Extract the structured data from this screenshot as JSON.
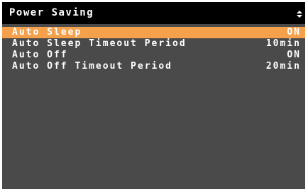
{
  "header": {
    "title": "Power Saving",
    "scroll_icon": "up-down-arrows-icon"
  },
  "colors": {
    "background": "#4a4a4a",
    "title_bar": "#000000",
    "highlight": "#f5a14c",
    "text": "#ffffff"
  },
  "menu": {
    "items": [
      {
        "label": "Auto Sleep",
        "value": "ON",
        "selected": true
      },
      {
        "label": "Auto Sleep Timeout Period",
        "value": "10min",
        "selected": false
      },
      {
        "label": "Auto Off",
        "value": "ON",
        "selected": false
      },
      {
        "label": "Auto Off Timeout Period",
        "value": "20min",
        "selected": false
      }
    ]
  }
}
